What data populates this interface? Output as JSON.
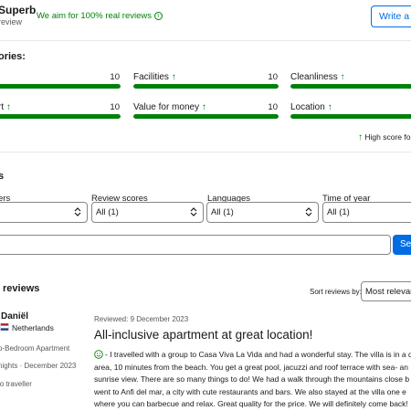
{
  "header": {
    "rating_word": "Superb",
    "review_text": "review",
    "real_reviews_note": "We aim for 100% real reviews",
    "write_review_label": "Write a re"
  },
  "categories": {
    "heading": "ories:",
    "items": [
      {
        "label": "",
        "score": "10",
        "value": 1.0
      },
      {
        "label": "Facilities",
        "score": "10",
        "value": 1.0
      },
      {
        "label": "Cleanliness",
        "score": "",
        "value": 1.0
      },
      {
        "label": "rt",
        "score": "10",
        "value": 1.0
      },
      {
        "label": "Value for money",
        "score": "10",
        "value": 1.0
      },
      {
        "label": "Location",
        "score": "",
        "value": 1.0
      }
    ],
    "high_score_note": "High score fo"
  },
  "filters": {
    "heading": "s",
    "items": [
      {
        "label": "ers",
        "value": ""
      },
      {
        "label": "Review scores",
        "value": "All (1)"
      },
      {
        "label": "Languages",
        "value": "All (1)"
      },
      {
        "label": "Time of year",
        "value": "All (1)"
      }
    ],
    "search_button": "Se"
  },
  "reviews": {
    "heading": "reviews",
    "sort_label": "Sort reviews by:",
    "sort_value": "Most relevant"
  },
  "reviewer": {
    "name": "Daniël",
    "country": "Netherlands",
    "room": "o-Bedroom Apartment",
    "stay": "nights · December 2023",
    "traveller_type": "lo traveller"
  },
  "review": {
    "date": "Reviewed: 9 December 2023",
    "title": "All-inclusive apartment at great location!",
    "lines": [
      "- I travelled with a group to Casa Viva La Vida and had a wonderful stay. The villa is in a q",
      "area, 10 minutes from the beach. You get a great pool, jacuzzi and roof terrace with sea- an",
      "sunrise view. There are so many things to do! We had a walk through the mountains close b",
      "went to Anfi del mar, a city with cute restaurants and bars. We also stayed at the villa one e",
      "where you can barbecue and relax. Great quality for the price. We will definitely come back!"
    ]
  },
  "colors": {
    "accent": "#006ce4",
    "positive": "#008009",
    "border": "#868686"
  }
}
